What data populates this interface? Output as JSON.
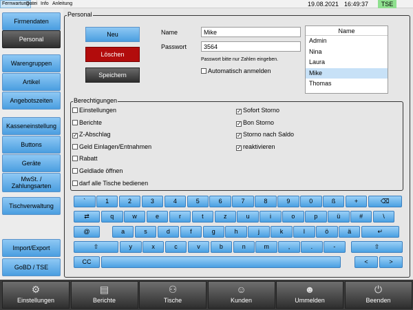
{
  "menu": [
    "Fernwartung",
    "Datei",
    "Info",
    "Anleitung"
  ],
  "status": {
    "date": "19.08.2021",
    "time": "16:49:37",
    "tse": "TSE"
  },
  "sidebar": {
    "items": [
      "Firmendaten",
      "Personal",
      "Warengruppen",
      "Artikel",
      "Angebotszeiten",
      "Kasseneinstellung",
      "Buttons",
      "Geräte",
      "MwSt. / Zahlungsarten",
      "Tischverwaltung",
      "Import/Export",
      "GoBD / TSE"
    ]
  },
  "personal": {
    "title": "Personal",
    "buttons": {
      "new": "Neu",
      "delete": "Löschen",
      "save": "Speichern"
    },
    "name_label": "Name",
    "name_value": "Mike",
    "password_label": "Passwort",
    "password_value": "3564",
    "hint": "Passwort bitte nur Zahlen eingeben.",
    "auto_login": "Automatisch anmelden",
    "list_header": "Name",
    "users": [
      "Admin",
      "Nina",
      "Laura",
      "Mike",
      "Thomas"
    ]
  },
  "permissions": {
    "title": "Berechtigungen",
    "left": [
      {
        "label": "Einstellungen",
        "checked": false
      },
      {
        "label": "Berichte",
        "checked": false
      },
      {
        "label": "Z-Abschlag",
        "checked": true
      },
      {
        "label": "Geld Einlagen/Entnahmen",
        "checked": false
      },
      {
        "label": "Rabatt",
        "checked": false
      },
      {
        "label": "Geldlade öffnen",
        "checked": false
      },
      {
        "label": "darf alle Tische bedienen",
        "checked": false
      }
    ],
    "right": [
      {
        "label": "Sofort Storno",
        "checked": true
      },
      {
        "label": "Bon Storno",
        "checked": true
      },
      {
        "label": "Storno nach Saldo",
        "checked": true
      },
      {
        "label": "reaktivieren",
        "checked": true
      }
    ]
  },
  "keyboard": {
    "row1": [
      "`",
      "1",
      "2",
      "3",
      "4",
      "5",
      "6",
      "7",
      "8",
      "9",
      "0",
      "ß",
      "+"
    ],
    "row2": [
      "q",
      "w",
      "e",
      "r",
      "t",
      "z",
      "u",
      "i",
      "o",
      "p",
      "ü",
      "#",
      "\\"
    ],
    "row3": [
      "@",
      "a",
      "s",
      "d",
      "f",
      "g",
      "h",
      "j",
      "k",
      "l",
      "ö",
      "ä"
    ],
    "row4": [
      "y",
      "x",
      "c",
      "v",
      "b",
      "n",
      "m",
      ",",
      ".",
      "-"
    ],
    "cc": "CC",
    "left": "<",
    "right": ">"
  },
  "bottom": [
    {
      "icon": "gear-icon",
      "label": "Einstellungen",
      "glyph": "⚙"
    },
    {
      "icon": "clipboard-icon",
      "label": "Berichte",
      "glyph": "▤"
    },
    {
      "icon": "table-people-icon",
      "label": "Tische",
      "glyph": "⚇"
    },
    {
      "icon": "customers-icon",
      "label": "Kunden",
      "glyph": "☺"
    },
    {
      "icon": "logout-user-icon",
      "label": "Ummelden",
      "glyph": "☻"
    },
    {
      "icon": "power-icon",
      "label": "Beenden",
      "glyph": "⏻"
    }
  ]
}
